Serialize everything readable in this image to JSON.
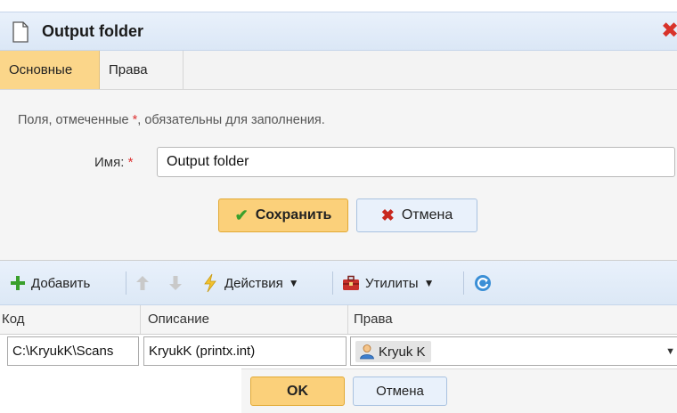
{
  "window": {
    "title": "Output folder",
    "icon": "document-icon",
    "close_icon": "close-icon"
  },
  "tabs": [
    {
      "label": "Основные",
      "active": true
    },
    {
      "label": "Права",
      "active": false
    }
  ],
  "form": {
    "hint_before": "Поля, отмеченные ",
    "hint_star": "*",
    "hint_after": ", обязательны для заполнения.",
    "name_label": "Имя:",
    "required_star": "*",
    "name_value": "Output folder",
    "save_label": "Сохранить",
    "cancel_label": "Отмена"
  },
  "toolbar": {
    "add_label": "Добавить",
    "actions_label": "Действия",
    "utilities_label": "Утилиты",
    "accent_color": "#3aa02c"
  },
  "grid": {
    "columns": [
      "Код",
      "Описание",
      "Права"
    ],
    "rows": [
      {
        "code": "C:\\KryukK\\Scans",
        "description": "KryukK (printx.int)",
        "rights": "Kryuk K"
      }
    ]
  },
  "footer": {
    "ok_label": "OK",
    "cancel_label": "Отмена"
  }
}
